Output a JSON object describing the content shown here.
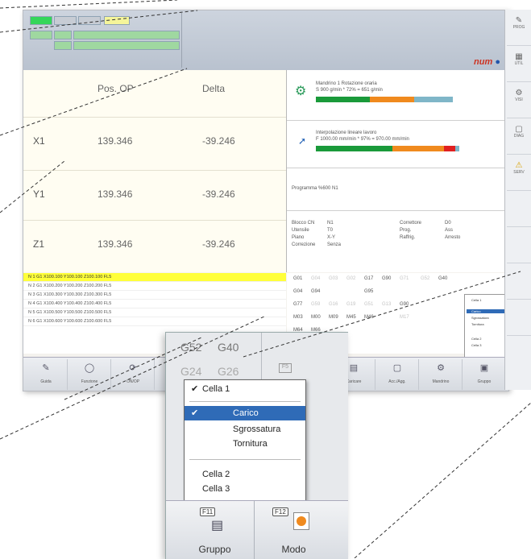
{
  "status": {
    "row1": [
      "",
      "",
      "",
      ""
    ],
    "row2": [
      "",
      "",
      ""
    ],
    "row3": [
      "",
      ""
    ]
  },
  "brand": "num",
  "axes": {
    "col_pos": "Pos. OP",
    "col_delta": "Delta",
    "rows": [
      {
        "name": "X1",
        "pos": "139.346",
        "delta": "-39.246"
      },
      {
        "name": "Y1",
        "pos": "139.346",
        "delta": "-39.246"
      },
      {
        "name": "Z1",
        "pos": "139.346",
        "delta": "-39.246"
      }
    ]
  },
  "spindle": {
    "line1": "Mandrino 1 Rotazione oraria",
    "line2": "S 900 g/min * 72% = 651 g/min",
    "fill_pct": 72
  },
  "interp": {
    "line1": "Interpolazione lineare lavoro",
    "line2": "F 1000.00 mm/min * 97% = 970.00 mm/min",
    "fill_pct": 97
  },
  "program": "Programma %600 N1",
  "cn_info": {
    "left": [
      [
        "Blocco CN",
        "N1"
      ],
      [
        "Utensile",
        "T0"
      ],
      [
        "Piano",
        "X-Y"
      ],
      [
        "Correzione",
        "Senza"
      ]
    ],
    "right": [
      [
        "Correttore",
        "D0"
      ],
      [
        "Prog.",
        "Ass"
      ],
      [
        "Raffrig.",
        "Arresto"
      ]
    ]
  },
  "program_lines": [
    "N 1 G1 X100.100 Y100.100 Z100.100 FL5",
    "N 2 G1 X100.200 Y100.200 Z100.200 FL5",
    "N 3 G1 X100.300 Y100.300 Z100.300 FL5",
    "N 4 G1 X100.400 Y100.400 Z100.400 FL5",
    "N 5 G1 X100.500 Y100.500 Z100.500 FL5",
    "N 6 G1 X100.600 Y100.600 Z100.600 FL5"
  ],
  "gcodes": [
    [
      "G01",
      "G04",
      "G03",
      "G02",
      "G17",
      "G90",
      "G71",
      "G52",
      "G40"
    ],
    [
      "G04",
      "G94",
      "",
      "G95",
      "",
      "",
      "",
      "",
      ""
    ],
    [
      "G77",
      "G59",
      "G16",
      "G19",
      "G51",
      "G13",
      "G90",
      "",
      ""
    ],
    [
      "M03",
      "M00",
      "M09",
      "M45",
      "M46",
      "",
      "M17",
      "",
      ""
    ],
    [
      "M64",
      "M66",
      "",
      "",
      "",
      "",
      "",
      "",
      ""
    ]
  ],
  "mini_menu": [
    "Cella 1",
    "Carico",
    "Sgrossatura",
    "Tornitura",
    "Cella 2",
    "Cella 3"
  ],
  "softkeys": [
    "Guida",
    "Funzione",
    "ON/OP",
    "",
    "",
    "",
    "Caricare",
    "Acc./Agg.",
    "Mandrino",
    "Gruppo",
    "Modo"
  ],
  "right_keys": [
    "PROG",
    "",
    "UTIL",
    "",
    "VISI",
    "",
    "DIAG",
    "",
    "SERV"
  ],
  "zoom": {
    "g_codes": [
      "G52",
      "G40",
      "G24",
      "G26"
    ],
    "menu": {
      "items": [
        "Cella 1",
        "Carico",
        "Sgrossatura",
        "Tornitura",
        "Cella 2",
        "Cella 3"
      ],
      "checked": [
        "Cella 1",
        "Carico"
      ],
      "selected": "Carico"
    },
    "softkeys": [
      {
        "fkey": "F11",
        "label": "Gruppo"
      },
      {
        "fkey": "F12",
        "label": "Modo"
      }
    ]
  },
  "colors": {
    "highlight_line": "#ffff3a",
    "menu_selected": "#2f6bb7",
    "bar_green": "#1a9a3a",
    "bar_orange": "#f08a1e",
    "bar_red": "#e02020",
    "bar_track": "#7fb6c8"
  }
}
